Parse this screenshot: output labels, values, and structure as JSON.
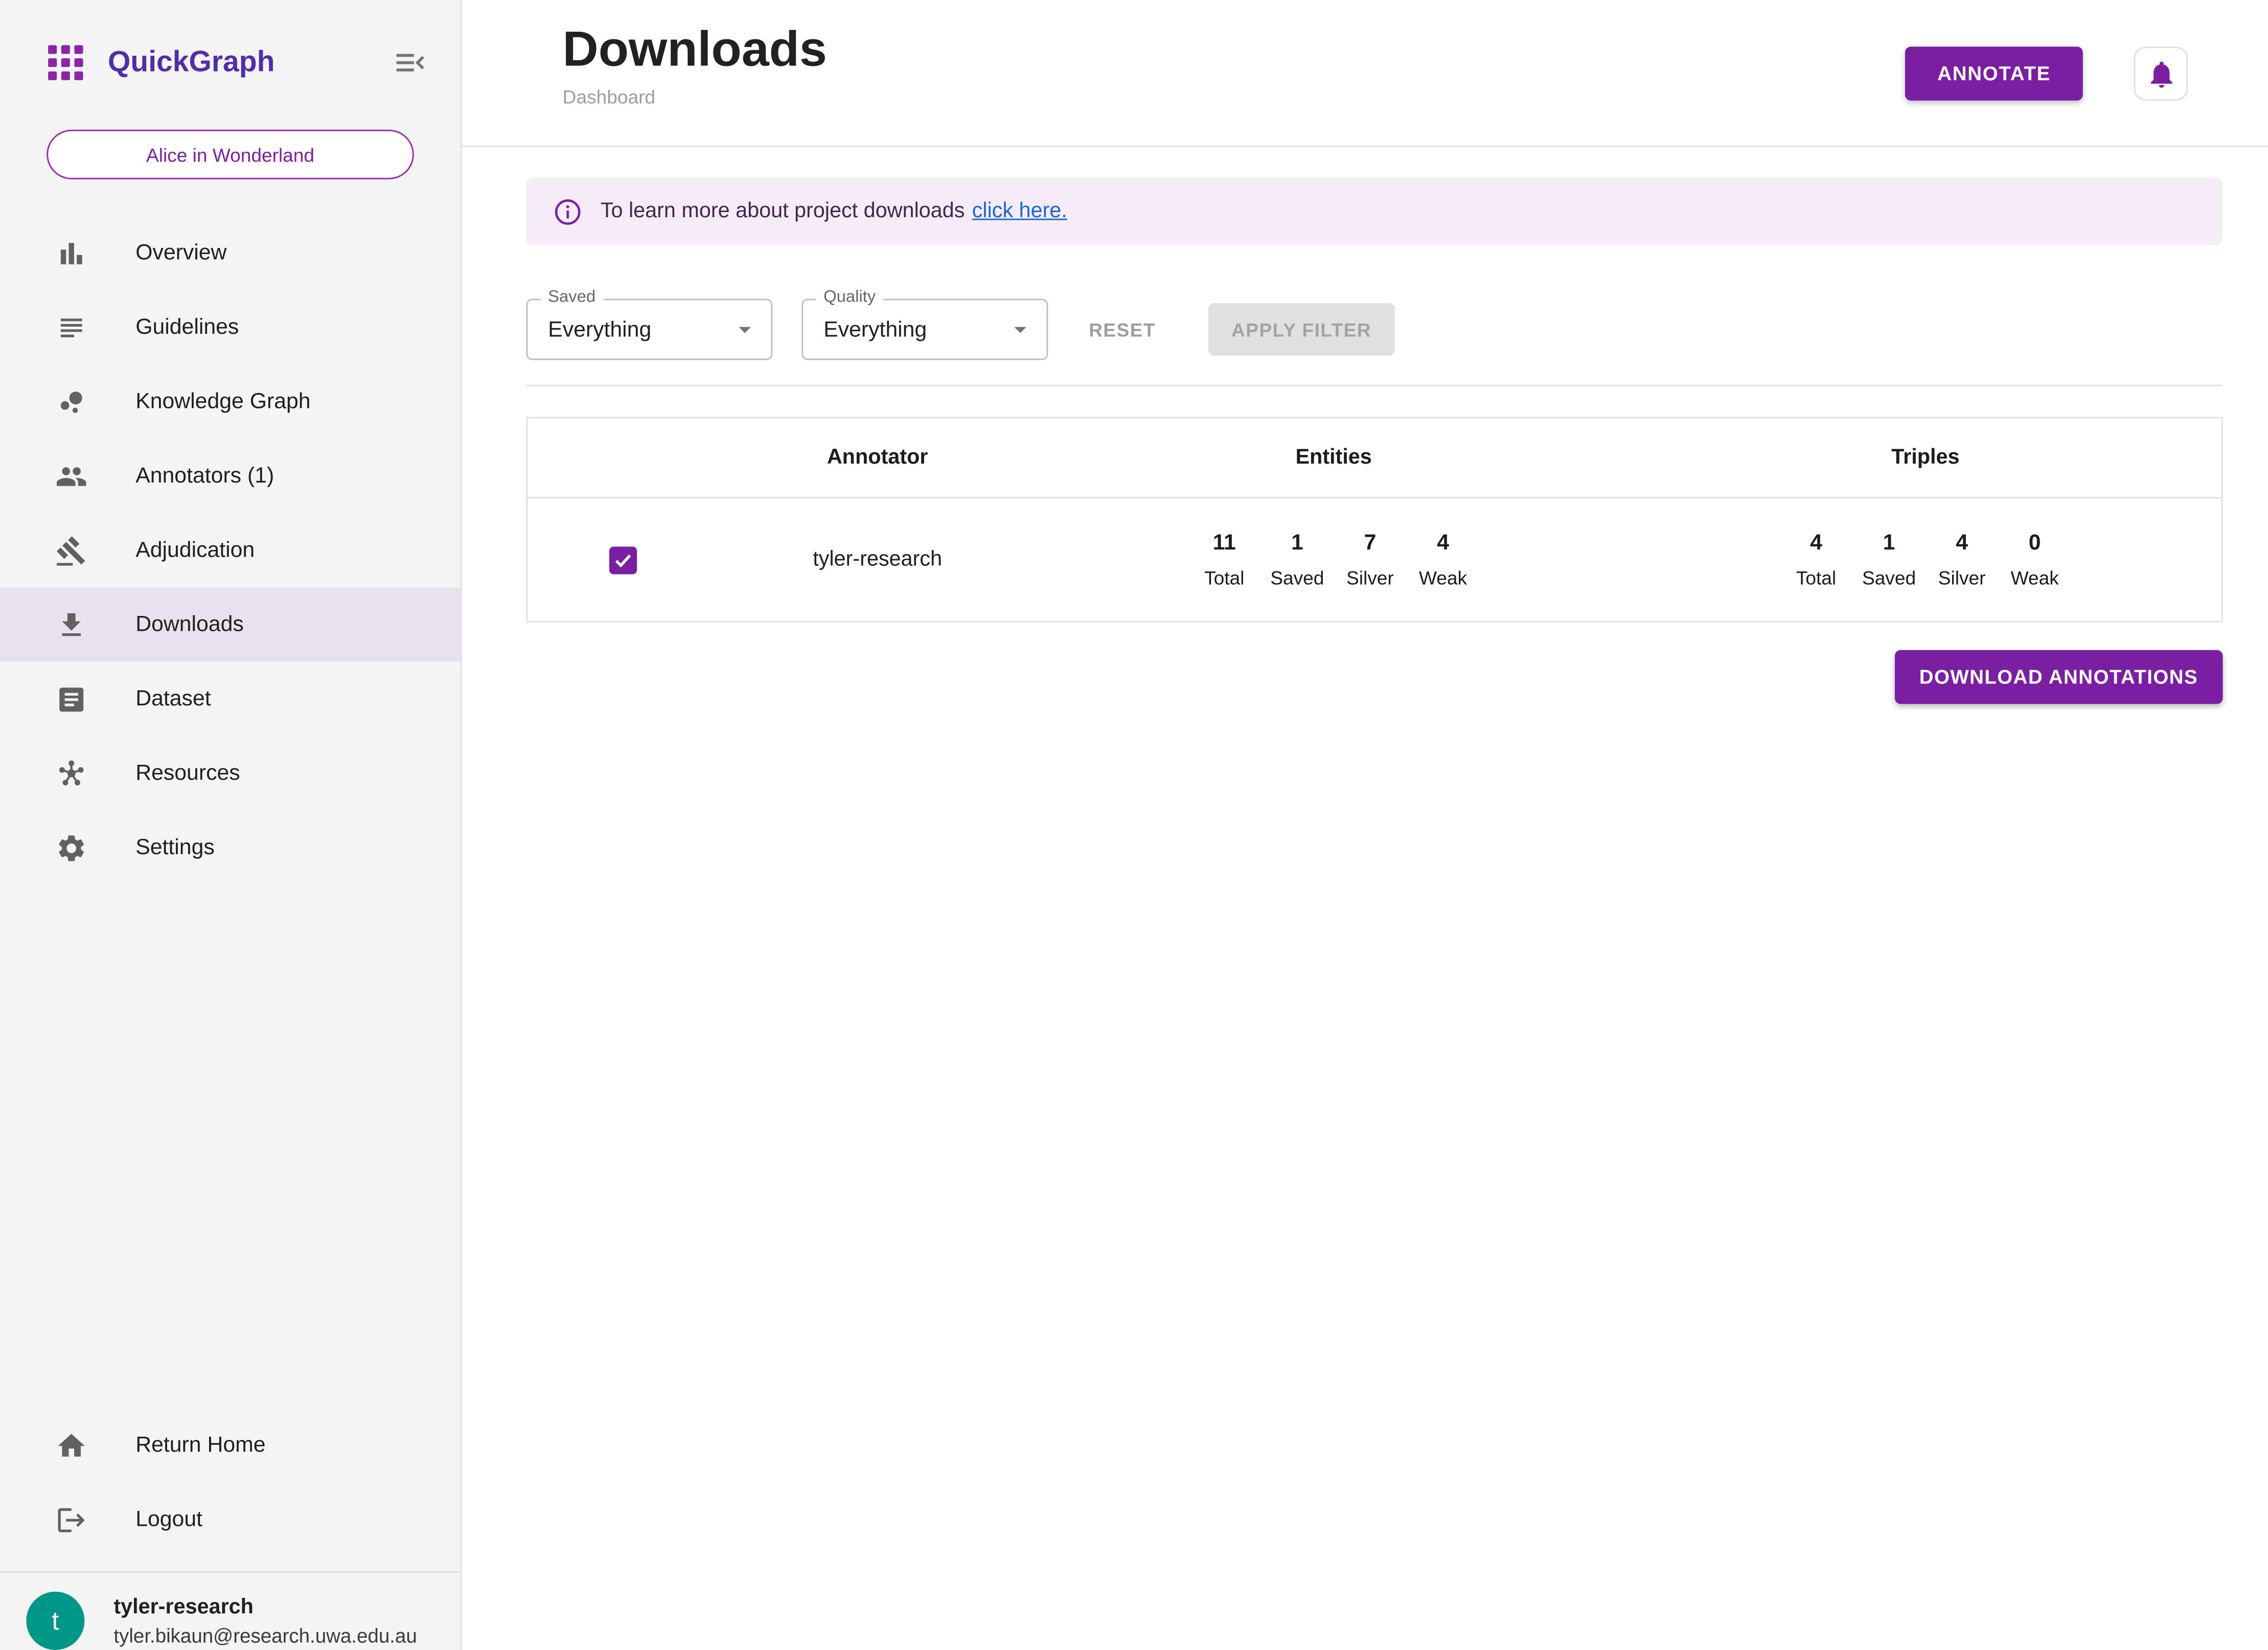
{
  "app": {
    "name": "QuickGraph"
  },
  "sidebar": {
    "project_button": "Alice in Wonderland",
    "nav": [
      {
        "label": "Overview",
        "icon": "bar-chart",
        "selected": false
      },
      {
        "label": "Guidelines",
        "icon": "notes",
        "selected": false
      },
      {
        "label": "Knowledge Graph",
        "icon": "bubble-chart",
        "selected": false
      },
      {
        "label": "Annotators (1)",
        "icon": "people",
        "selected": false
      },
      {
        "label": "Adjudication",
        "icon": "gavel",
        "selected": false
      },
      {
        "label": "Downloads",
        "icon": "download",
        "selected": true
      },
      {
        "label": "Dataset",
        "icon": "article",
        "selected": false
      },
      {
        "label": "Resources",
        "icon": "hub",
        "selected": false
      },
      {
        "label": "Settings",
        "icon": "gear",
        "selected": false
      }
    ],
    "footer_nav": [
      {
        "label": "Return Home",
        "icon": "home"
      },
      {
        "label": "Logout",
        "icon": "logout"
      }
    ],
    "user": {
      "initial": "t",
      "name": "tyler-research",
      "email": "tyler.bikaun@research.uwa.edu.au"
    }
  },
  "header": {
    "title": "Downloads",
    "subtitle": "Dashboard",
    "annotate_button": "ANNOTATE",
    "bell_icon": "notifications-bell"
  },
  "banner": {
    "icon": "info-circle",
    "text": "To learn more about project downloads",
    "link": "click here."
  },
  "filters": {
    "saved": {
      "label": "Saved",
      "value": "Everything"
    },
    "quality": {
      "label": "Quality",
      "value": "Everything"
    },
    "reset_label": "RESET",
    "apply_label": "APPLY FILTER"
  },
  "table": {
    "columns": [
      "Annotator",
      "Entities",
      "Triples"
    ],
    "rows": [
      {
        "checked": true,
        "annotator": "tyler-research",
        "entities_stats": [
          {
            "value": "11",
            "label": "Total"
          },
          {
            "value": "1",
            "label": "Saved"
          },
          {
            "value": "7",
            "label": "Silver"
          },
          {
            "value": "4",
            "label": "Weak"
          }
        ],
        "triples_stats": [
          {
            "value": "4",
            "label": "Total"
          },
          {
            "value": "1",
            "label": "Saved"
          },
          {
            "value": "4",
            "label": "Silver"
          },
          {
            "value": "0",
            "label": "Weak"
          }
        ]
      }
    ]
  },
  "actions": {
    "download_button": "DOWNLOAD ANNOTATIONS"
  },
  "colors": {
    "brand_purple": "#7b1fa2",
    "logo_text_purple": "#512da8",
    "logo_grid_purple": "#8e24aa",
    "selected_nav_bg": "#e9e2ee",
    "banner_bg": "#f5ecf8",
    "banner_text": "#3e2750",
    "link_blue": "#1967d2",
    "avatar_teal": "#009688",
    "sidebar_bg": "#f4f4f4",
    "border_gray": "#e0e0e0"
  }
}
